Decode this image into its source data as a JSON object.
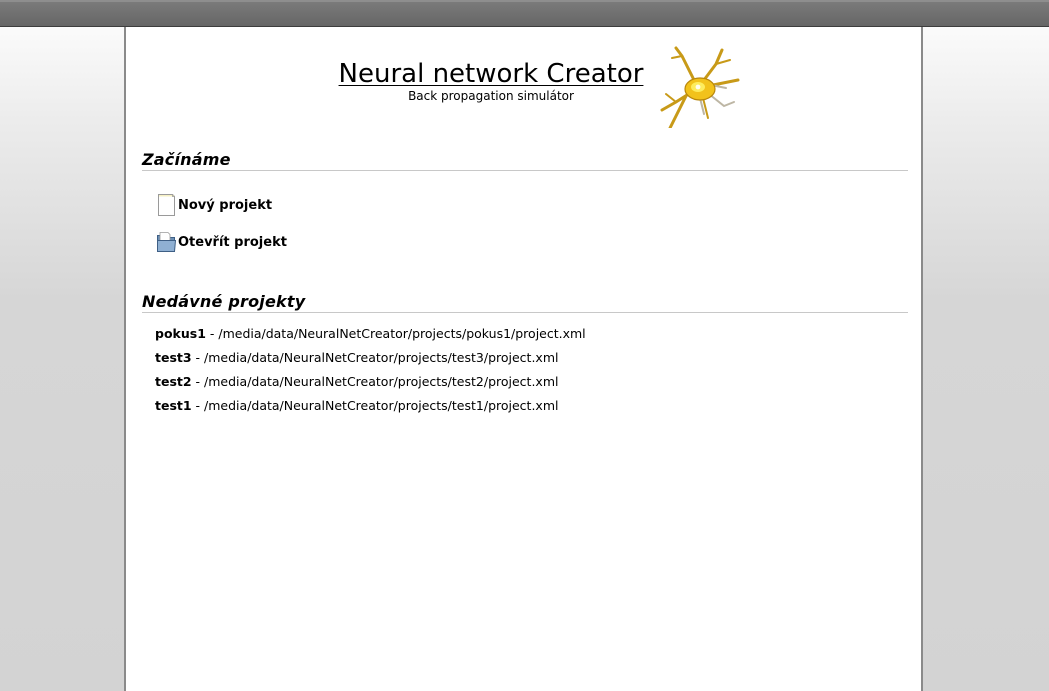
{
  "header": {
    "title": "Neural network Creator",
    "subtitle": "Back propagation simulátor"
  },
  "getting_started": {
    "heading": "Začínáme",
    "actions": [
      {
        "label": "Nový projekt",
        "icon": "new-document-icon"
      },
      {
        "label": "Otevřít projekt",
        "icon": "open-folder-icon"
      }
    ]
  },
  "recent_projects": {
    "heading": "Nedávné projekty",
    "separator": " - ",
    "items": [
      {
        "name": "pokus1",
        "path": "/media/data/NeuralNetCreator/projects/pokus1/project.xml"
      },
      {
        "name": "test3",
        "path": "/media/data/NeuralNetCreator/projects/test3/project.xml"
      },
      {
        "name": "test2",
        "path": "/media/data/NeuralNetCreator/projects/test2/project.xml"
      },
      {
        "name": "test1",
        "path": "/media/data/NeuralNetCreator/projects/test1/project.xml"
      }
    ]
  },
  "colors": {
    "page_background": "#ffffff",
    "outer_background": "#d3d3d3",
    "rule": "#c8c8c8",
    "neuron_body": "#f2c21b"
  }
}
